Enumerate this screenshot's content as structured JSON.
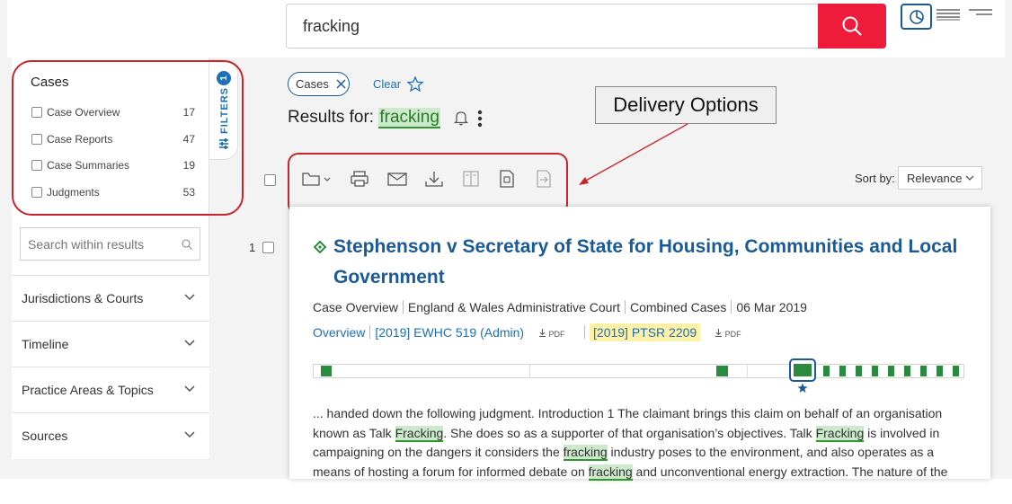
{
  "search": {
    "query": "fracking"
  },
  "sidebar": {
    "cases_title": "Cases",
    "facets": [
      {
        "label": "Case Overview",
        "count": "17"
      },
      {
        "label": "Case Reports",
        "count": "47"
      },
      {
        "label": "Case Summaries",
        "count": "19"
      },
      {
        "label": "Judgments",
        "count": "53"
      }
    ],
    "filters_tab": {
      "label": "FILTERS",
      "count": "1"
    },
    "search_within_placeholder": "Search within results",
    "accordions": [
      "Jurisdictions & Courts",
      "Timeline",
      "Practice Areas & Topics",
      "Sources"
    ]
  },
  "main": {
    "chip_label": "Cases",
    "clear_label": "Clear",
    "results_prefix": "Results for:",
    "results_term": "fracking",
    "sort_label": "Sort by:",
    "sort_value": "Relevance"
  },
  "callout": {
    "label": "Delivery Options",
    "color": "#c8242b"
  },
  "toolbar_icons": [
    "folder-icon",
    "print-icon",
    "email-icon",
    "download-icon",
    "book-icon",
    "page-scan-icon",
    "export-icon"
  ],
  "result": {
    "number": "1",
    "title": "Stephenson v Secretary of State for Housing, Communities and Local Government",
    "meta": [
      "Case Overview",
      "England & Wales Administrative Court",
      "Combined Cases",
      "06 Mar 2019"
    ],
    "links": {
      "overview": "Overview",
      "citation1": "[2019] EWHC 519 (Admin)",
      "citation2": "[2019] PTSR 2209",
      "pdf": "PDF"
    },
    "snippet": [
      {
        "t": "... handed down the following judgment. Introduction 1 The claimant brings this claim on behalf of an organisation known as Talk ",
        "h": false
      },
      {
        "t": "Fracking",
        "h": true
      },
      {
        "t": ". She does so as a supporter of that organisation’s objectives. Talk ",
        "h": false
      },
      {
        "t": "Fracking",
        "h": true
      },
      {
        "t": " is involved in campaigning on the dangers it considers the ",
        "h": false
      },
      {
        "t": "fracking",
        "h": true
      },
      {
        "t": " industry poses to the environment, and also operates as a means of hosting a forum for informed debate on ",
        "h": false
      },
      {
        "t": "fracking",
        "h": true
      },
      {
        "t": " and unconventional energy extraction. The nature of the",
        "h": false
      }
    ]
  },
  "colors": {
    "brand_blue": "#1a5a96",
    "search_red": "#ee1c3a",
    "highlight_green": "#2d9a2d"
  }
}
